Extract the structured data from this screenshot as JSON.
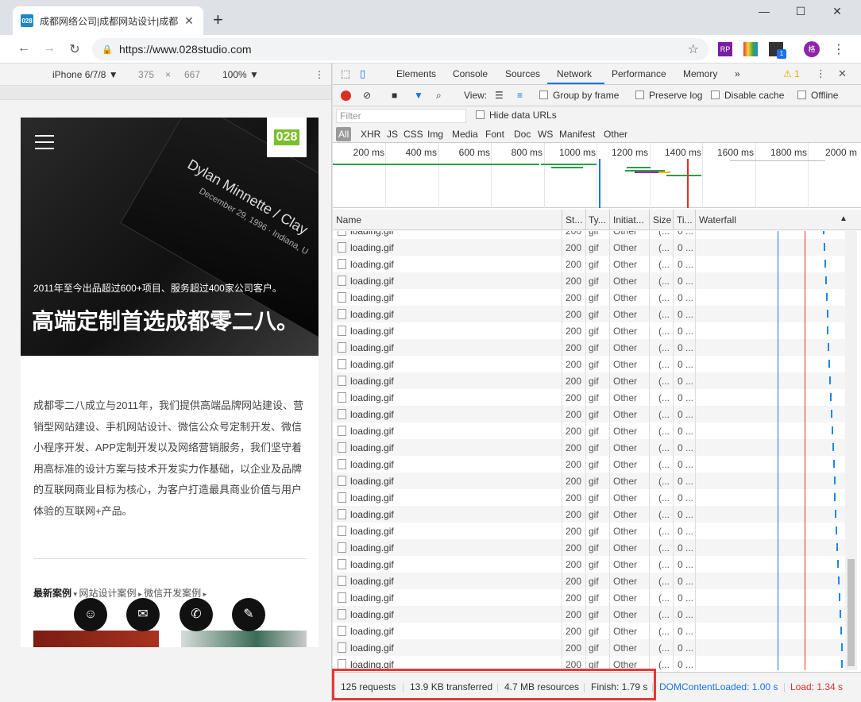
{
  "browser": {
    "tab_title": "成都网络公司|成都网站设计|成都",
    "tab_favicon": "028",
    "url": "https://www.028studio.com",
    "avatar_label": "格",
    "ext_badge": "1",
    "ext_rp": "RP"
  },
  "device_toolbar": {
    "device": "iPhone 6/7/8 ▼",
    "width": "375",
    "times": "×",
    "height": "667",
    "zoom": "100% ▼"
  },
  "site": {
    "logo": "028",
    "card_title": "Dylan Minnette / Clay",
    "card_sub": "December 29, 1996 · Indiana, U",
    "tagline": "2011年至今出品超过600+项目、服务超过400家公司客户。",
    "headline": "高端定制首选成都零二八。",
    "about": "成都零二八成立与2011年，我们提供高端品牌网站建设、营销型网站建设、手机网站设计、微信公众号定制开发、微信小程序开发、APP定制开发以及网络营销服务，我们坚守着用高标准的设计方案与技术开发实力作基础，以企业及品牌的互联网商业目标为核心，为客户打造最具商业价值与用户体验的互联网+产品。",
    "cases": {
      "active": "最新案例",
      "tab2": "网站设计案例",
      "tab3": "微信开发案例"
    }
  },
  "devtools": {
    "tabs": [
      "Elements",
      "Console",
      "Sources",
      "Network",
      "Performance",
      "Memory"
    ],
    "active_tab": "Network",
    "more": "»",
    "warning_count": "1",
    "close": "✕",
    "toolbar": {
      "view_label": "View:",
      "group_by_frame": "Group by frame",
      "preserve_log": "Preserve log",
      "disable_cache": "Disable cache",
      "offline": "Offline"
    },
    "filter_placeholder": "Filter",
    "hide_data_urls": "Hide data URLs",
    "types": [
      "All",
      "XHR",
      "JS",
      "CSS",
      "Img",
      "Media",
      "Font",
      "Doc",
      "WS",
      "Manifest",
      "Other"
    ],
    "timeline_ticks": [
      "200 ms",
      "400 ms",
      "600 ms",
      "800 ms",
      "1000 ms",
      "1200 ms",
      "1400 ms",
      "1600 ms",
      "1800 ms",
      "2000 m"
    ],
    "columns": {
      "name": "Name",
      "status": "St...",
      "type": "Ty...",
      "initiator": "Initiat...",
      "size": "Size",
      "time": "Ti...",
      "waterfall": "Waterfall"
    },
    "rows": [
      {
        "name": "loading.gif",
        "status": "200",
        "type": "gif",
        "initiator": "Other",
        "size": "(...",
        "time": "0 ..."
      },
      {
        "name": "loading.gif",
        "status": "200",
        "type": "gif",
        "initiator": "Other",
        "size": "(...",
        "time": "0 ..."
      },
      {
        "name": "loading.gif",
        "status": "200",
        "type": "gif",
        "initiator": "Other",
        "size": "(...",
        "time": "0 ..."
      },
      {
        "name": "loading.gif",
        "status": "200",
        "type": "gif",
        "initiator": "Other",
        "size": "(...",
        "time": "0 ..."
      },
      {
        "name": "loading.gif",
        "status": "200",
        "type": "gif",
        "initiator": "Other",
        "size": "(...",
        "time": "0 ..."
      },
      {
        "name": "loading.gif",
        "status": "200",
        "type": "gif",
        "initiator": "Other",
        "size": "(...",
        "time": "0 ..."
      },
      {
        "name": "loading.gif",
        "status": "200",
        "type": "gif",
        "initiator": "Other",
        "size": "(...",
        "time": "0 ..."
      },
      {
        "name": "loading.gif",
        "status": "200",
        "type": "gif",
        "initiator": "Other",
        "size": "(...",
        "time": "0 ..."
      },
      {
        "name": "loading.gif",
        "status": "200",
        "type": "gif",
        "initiator": "Other",
        "size": "(...",
        "time": "0 ..."
      },
      {
        "name": "loading.gif",
        "status": "200",
        "type": "gif",
        "initiator": "Other",
        "size": "(...",
        "time": "0 ..."
      },
      {
        "name": "loading.gif",
        "status": "200",
        "type": "gif",
        "initiator": "Other",
        "size": "(...",
        "time": "0 ..."
      },
      {
        "name": "loading.gif",
        "status": "200",
        "type": "gif",
        "initiator": "Other",
        "size": "(...",
        "time": "0 ..."
      },
      {
        "name": "loading.gif",
        "status": "200",
        "type": "gif",
        "initiator": "Other",
        "size": "(...",
        "time": "0 ..."
      },
      {
        "name": "loading.gif",
        "status": "200",
        "type": "gif",
        "initiator": "Other",
        "size": "(...",
        "time": "0 ..."
      },
      {
        "name": "loading.gif",
        "status": "200",
        "type": "gif",
        "initiator": "Other",
        "size": "(...",
        "time": "0 ..."
      },
      {
        "name": "loading.gif",
        "status": "200",
        "type": "gif",
        "initiator": "Other",
        "size": "(...",
        "time": "0 ..."
      },
      {
        "name": "loading.gif",
        "status": "200",
        "type": "gif",
        "initiator": "Other",
        "size": "(...",
        "time": "0 ..."
      },
      {
        "name": "loading.gif",
        "status": "200",
        "type": "gif",
        "initiator": "Other",
        "size": "(...",
        "time": "0 ..."
      },
      {
        "name": "loading.gif",
        "status": "200",
        "type": "gif",
        "initiator": "Other",
        "size": "(...",
        "time": "0 ..."
      },
      {
        "name": "loading.gif",
        "status": "200",
        "type": "gif",
        "initiator": "Other",
        "size": "(...",
        "time": "0 ..."
      },
      {
        "name": "loading.gif",
        "status": "200",
        "type": "gif",
        "initiator": "Other",
        "size": "(...",
        "time": "0 ..."
      },
      {
        "name": "loading.gif",
        "status": "200",
        "type": "gif",
        "initiator": "Other",
        "size": "(...",
        "time": "0 ..."
      },
      {
        "name": "loading.gif",
        "status": "200",
        "type": "gif",
        "initiator": "Other",
        "size": "(...",
        "time": "0 ..."
      },
      {
        "name": "loading.gif",
        "status": "200",
        "type": "gif",
        "initiator": "Other",
        "size": "(...",
        "time": "0 ..."
      },
      {
        "name": "loading.gif",
        "status": "200",
        "type": "gif",
        "initiator": "Other",
        "size": "(...",
        "time": "0 ..."
      },
      {
        "name": "loading.gif",
        "status": "200",
        "type": "gif",
        "initiator": "Other",
        "size": "(...",
        "time": "0 ..."
      },
      {
        "name": "loading.gif",
        "status": "200",
        "type": "gif",
        "initiator": "Other",
        "size": "(...",
        "time": "0 ..."
      }
    ],
    "status": {
      "requests": "125 requests",
      "transferred": "13.9 KB transferred",
      "resources": "4.7 MB resources",
      "finish": "Finish: 1.79 s",
      "dom_content_loaded": "DOMContentLoaded: 1.00 s",
      "load": "Load: 1.34 s"
    }
  },
  "colors": {
    "record": "#d93025",
    "dcl": "#1a73e8",
    "load": "#d93025",
    "highlight_box": "#e53935"
  }
}
